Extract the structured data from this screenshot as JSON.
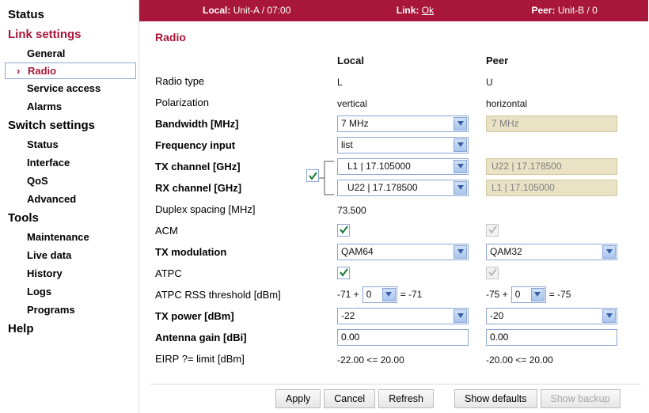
{
  "topbar": {
    "local_label": "Local:",
    "local_value": "Unit-A / 07:00",
    "link_label": "Link:",
    "link_value": "Ok",
    "peer_label": "Peer:",
    "peer_value": "Unit-B / 0"
  },
  "nav": {
    "status": "Status",
    "link_settings": "Link settings",
    "general": "General",
    "radio": "Radio",
    "service_access": "Service access",
    "alarms": "Alarms",
    "switch_settings": "Switch settings",
    "sw_status": "Status",
    "interface": "Interface",
    "qos": "QoS",
    "advanced": "Advanced",
    "tools": "Tools",
    "maintenance": "Maintenance",
    "live_data": "Live data",
    "history": "History",
    "logs": "Logs",
    "programs": "Programs",
    "help": "Help"
  },
  "section_title": "Radio",
  "headers": {
    "local": "Local",
    "peer": "Peer"
  },
  "labels": {
    "radio_type": "Radio type",
    "polarization": "Polarization",
    "bandwidth": "Bandwidth [MHz]",
    "freq_input": "Frequency input",
    "tx_channel": "TX channel [GHz]",
    "rx_channel": "RX channel [GHz]",
    "duplex": "Duplex spacing [MHz]",
    "acm": "ACM",
    "tx_mod": "TX modulation",
    "atpc": "ATPC",
    "atpc_rss": "ATPC RSS threshold [dBm]",
    "tx_power": "TX power [dBm]",
    "ant_gain": "Antenna gain [dBi]",
    "eirp": "EIRP ?= limit [dBm]"
  },
  "local": {
    "radio_type": "L",
    "polarization": "vertical",
    "bandwidth": "7 MHz",
    "freq_input": "list",
    "tx_channel": "L1 | 17.105000",
    "rx_channel": "U22 | 17.178500",
    "duplex": "73.500",
    "acm_checked": true,
    "tx_mod": "QAM64",
    "atpc_checked": true,
    "atpc_base": "-71 +",
    "atpc_offset": "0",
    "atpc_result": "= -71",
    "tx_power": "-22",
    "ant_gain": "0.00",
    "eirp": "-22.00 <= 20.00"
  },
  "peer": {
    "radio_type": "U",
    "polarization": "horizontal",
    "bandwidth": "7 MHz",
    "tx_channel": "U22 | 17.178500",
    "rx_channel": "L1 | 17.105000",
    "acm_checked": true,
    "tx_mod": "QAM32",
    "atpc_checked": true,
    "atpc_base": "-75 +",
    "atpc_offset": "0",
    "atpc_result": "= -75",
    "tx_power": "-20",
    "ant_gain": "0.00",
    "eirp": "-20.00 <= 20.00"
  },
  "link_checked": true,
  "buttons": {
    "apply": "Apply",
    "cancel": "Cancel",
    "refresh": "Refresh",
    "show_defaults": "Show defaults",
    "show_backup": "Show backup"
  }
}
